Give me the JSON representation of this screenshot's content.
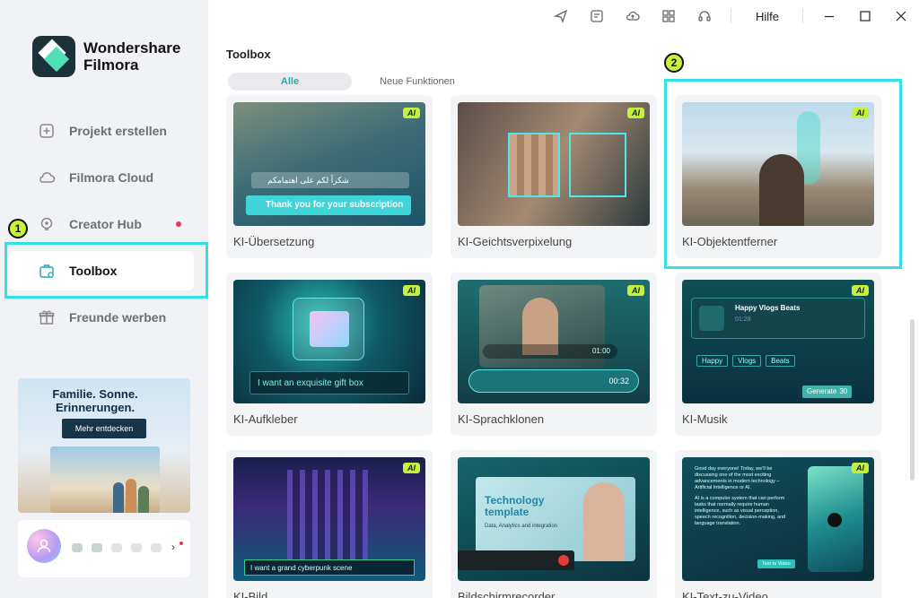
{
  "app": {
    "logo_line1": "Wondershare",
    "logo_line2": "Filmora"
  },
  "sidebar": {
    "items": [
      {
        "label": "Projekt erstellen",
        "icon": "plus-square-icon"
      },
      {
        "label": "Filmora Cloud",
        "icon": "cloud-icon"
      },
      {
        "label": "Creator Hub",
        "icon": "bulb-icon"
      },
      {
        "label": "Toolbox",
        "icon": "toolbox-icon"
      },
      {
        "label": "Freunde werben",
        "icon": "gift-icon"
      }
    ],
    "active_index": 3,
    "promo": {
      "title_line1": "Familie. Sonne.",
      "title_line2": "Erinnerungen.",
      "button": "Mehr entdecken"
    }
  },
  "annotations": {
    "badge1": "1",
    "badge2": "2",
    "highlight_color": "#33e0e8"
  },
  "topbar": {
    "icons": [
      "send-icon",
      "checklist-icon",
      "cloud-upload-icon",
      "grid-icon",
      "headset-icon"
    ],
    "help": "Hilfe",
    "window_controls": [
      "minimize-icon",
      "maximize-icon",
      "close-icon"
    ]
  },
  "main": {
    "title": "Toolbox",
    "tabs": [
      "Alle",
      "Neue Funktionen"
    ],
    "ai_tag": "AI",
    "cards": [
      {
        "label": "KI-Übersetzung",
        "thumb_text": "Thank you for your subscription",
        "thumb_text_ar": "شكراً لكم على اهتمامكم"
      },
      {
        "label": "KI-Geichtsverpixelung"
      },
      {
        "label": "KI-Objektentferner"
      },
      {
        "label": "KI-Aufkleber",
        "thumb_text": "I want an exquisite gift box"
      },
      {
        "label": "KI-Sprachklonen",
        "thumb_time1": "01:00",
        "thumb_time2": "00:32"
      },
      {
        "label": "KI-Musik",
        "thumb_title": "Happy Vlogs Beats",
        "thumb_time": "01:28",
        "tags": [
          "Happy",
          "Vlogs",
          "Beats"
        ],
        "gen": "Generate",
        "gen_count": "30"
      },
      {
        "label": "KI-Bild",
        "thumb_text": "I want a grand cyberpunk scene"
      },
      {
        "label": "Bildschirmrecorder",
        "thumb_title1": "Technology",
        "thumb_title2": "template",
        "thumb_sub": "Data, Analytics and integration"
      },
      {
        "label": "KI-Text-zu-Video",
        "thumb_para1": "Good day everyone! Today, we'll be discussing one of the most exciting advancements in modern technology – Artificial Intelligence or AI.",
        "thumb_para2": "AI is a computer system that can perform tasks that normally require human intelligence, such as visual perception, speech recognition, decision-making, and language translation.",
        "thumb_btn": "Text to Video"
      }
    ]
  },
  "colors": {
    "accent": "#2aa7b2",
    "ai_tag": "#c6f03a",
    "red_dot": "#e53b4f",
    "badge": "#c9f23a"
  }
}
